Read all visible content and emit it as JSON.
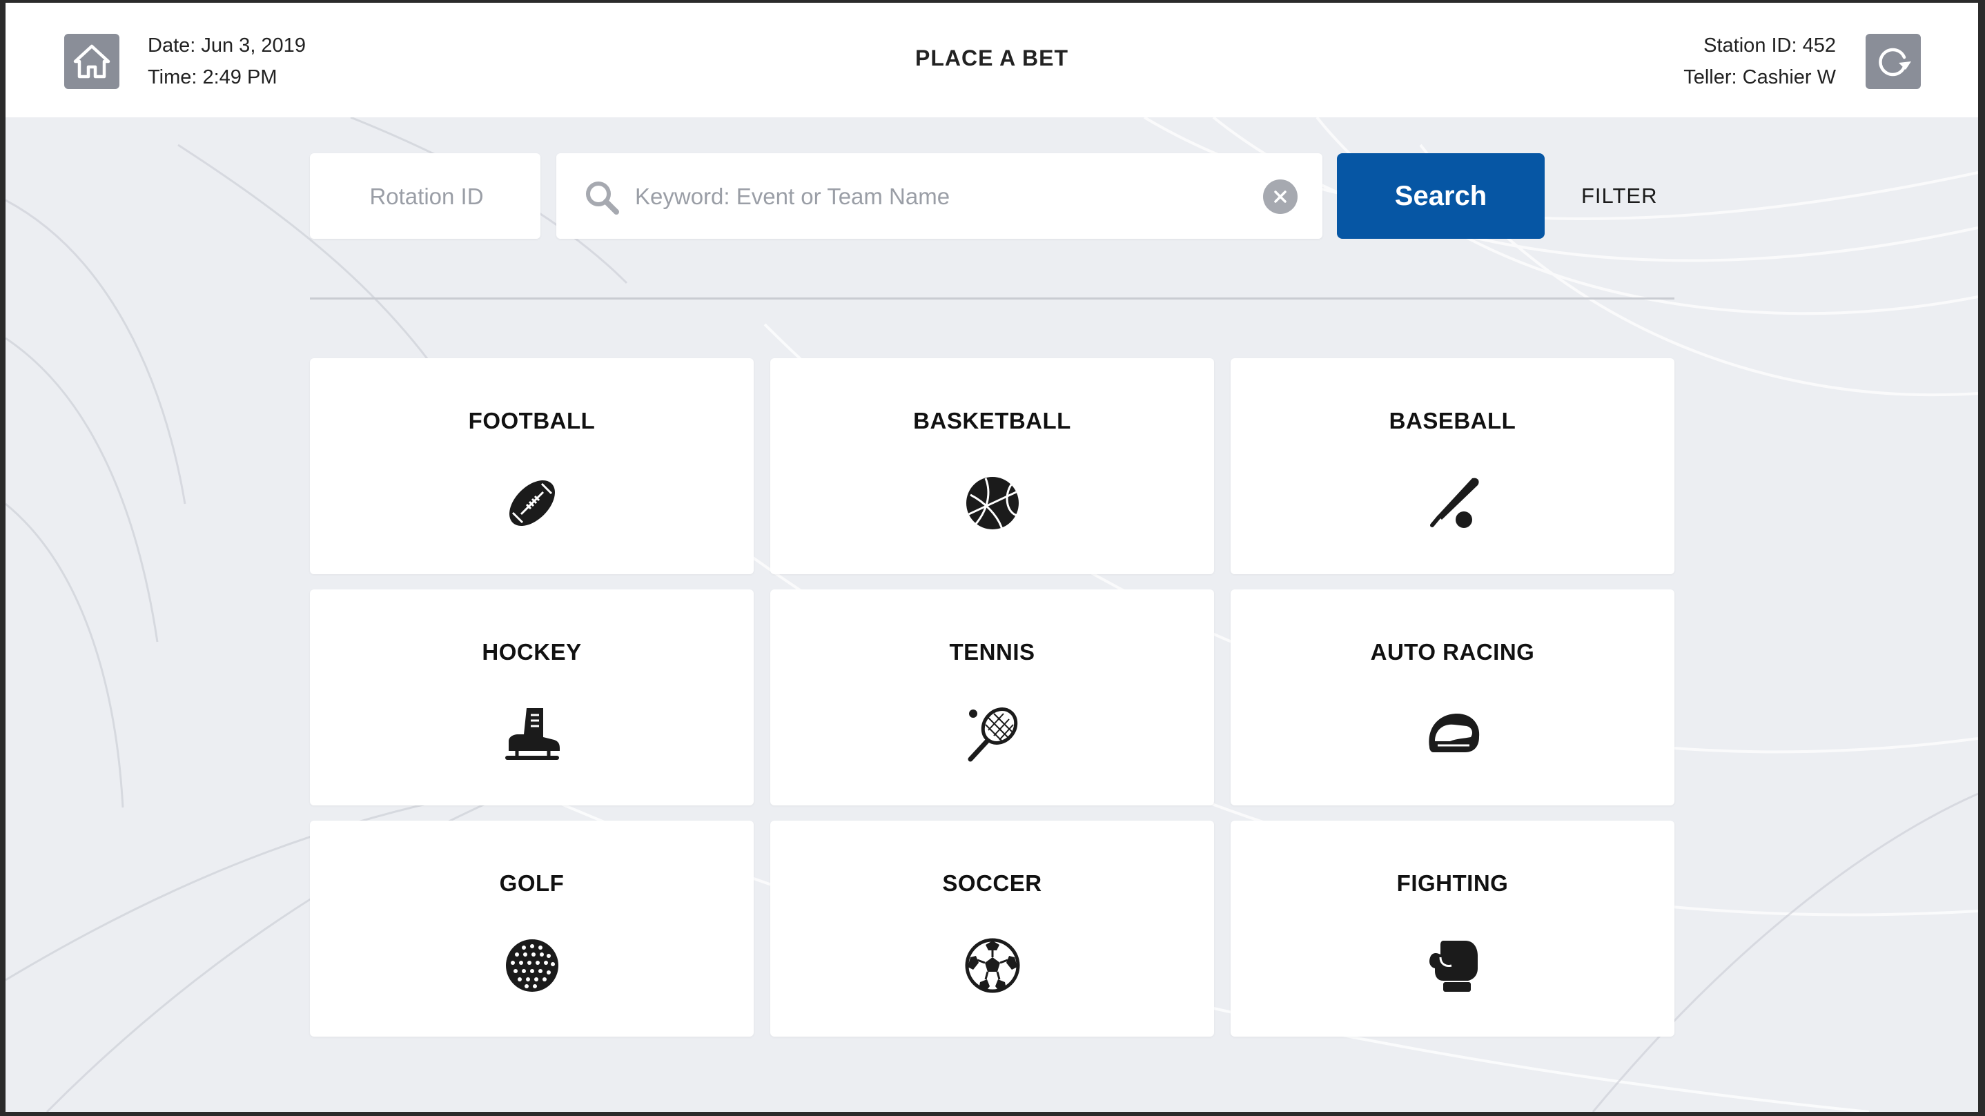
{
  "header": {
    "date": "Date: Jun 3, 2019",
    "time": "Time: 2:49 PM",
    "title": "PLACE A BET",
    "station": "Station ID: 452",
    "teller": "Teller: Cashier W"
  },
  "search": {
    "rotation_placeholder": "Rotation ID",
    "keyword_placeholder": "Keyword: Event or Team Name",
    "search_label": "Search",
    "filter_label": "FILTER"
  },
  "sports": [
    {
      "label": "FOOTBALL",
      "icon": "football-icon"
    },
    {
      "label": "BASKETBALL",
      "icon": "basketball-icon"
    },
    {
      "label": "BASEBALL",
      "icon": "baseball-bat-icon"
    },
    {
      "label": "HOCKEY",
      "icon": "ice-skate-icon"
    },
    {
      "label": "TENNIS",
      "icon": "tennis-racket-icon"
    },
    {
      "label": "AUTO RACING",
      "icon": "racing-helmet-icon"
    },
    {
      "label": "GOLF",
      "icon": "golf-ball-icon"
    },
    {
      "label": "SOCCER",
      "icon": "soccer-ball-icon"
    },
    {
      "label": "FIGHTING",
      "icon": "boxing-glove-icon"
    }
  ],
  "colors": {
    "primary_button": "#0656a4",
    "header_icon_bg": "#8a8e98",
    "background": "#eceef2"
  }
}
